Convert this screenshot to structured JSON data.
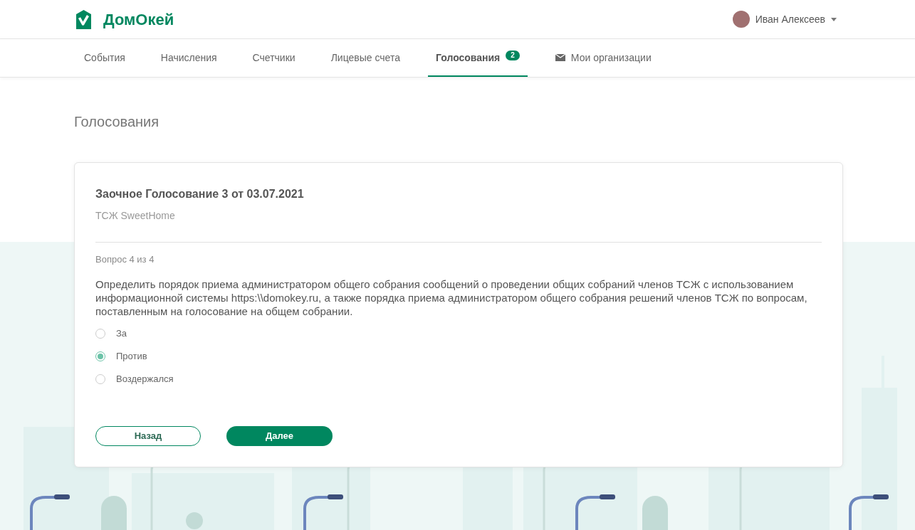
{
  "header": {
    "logo": "ДомОкей",
    "user": {
      "name": "Иван Алексеев"
    }
  },
  "nav": [
    {
      "label": "События",
      "selected": false,
      "kind": "plain"
    },
    {
      "label": "Начисления",
      "selected": false,
      "kind": "plain"
    },
    {
      "label": "Счетчики",
      "selected": false,
      "kind": "plain"
    },
    {
      "label": "Лицевые счета",
      "selected": false,
      "kind": "plain"
    },
    {
      "label": "Голосования",
      "selected": true,
      "kind": "plain",
      "badge": "2"
    },
    {
      "label": "Мои организации",
      "selected": false,
      "kind": "mail"
    }
  ],
  "page_title": "Голосования",
  "vote": {
    "title": "Заочное Голосование 3 от 03.07.2021",
    "organization": "ТСЖ SweetHome",
    "question_number": "Вопрос 4 из 4",
    "question": "Определить порядок приема администратором общего собрания сообщений о проведении общих собраний членов ТСЖ с использованием информационной системы https:\\\\domokey.ru, а также порядка приема администратором общего собрания решений членов ТСЖ по вопросам, поставленным на голосование на общем собрании.",
    "options": [
      {
        "label": "За",
        "selected": false
      },
      {
        "label": "Против",
        "selected": true
      },
      {
        "label": "Воздержался",
        "selected": false
      }
    ],
    "buttons": {
      "back": "Назад",
      "next": "Далее"
    }
  }
}
